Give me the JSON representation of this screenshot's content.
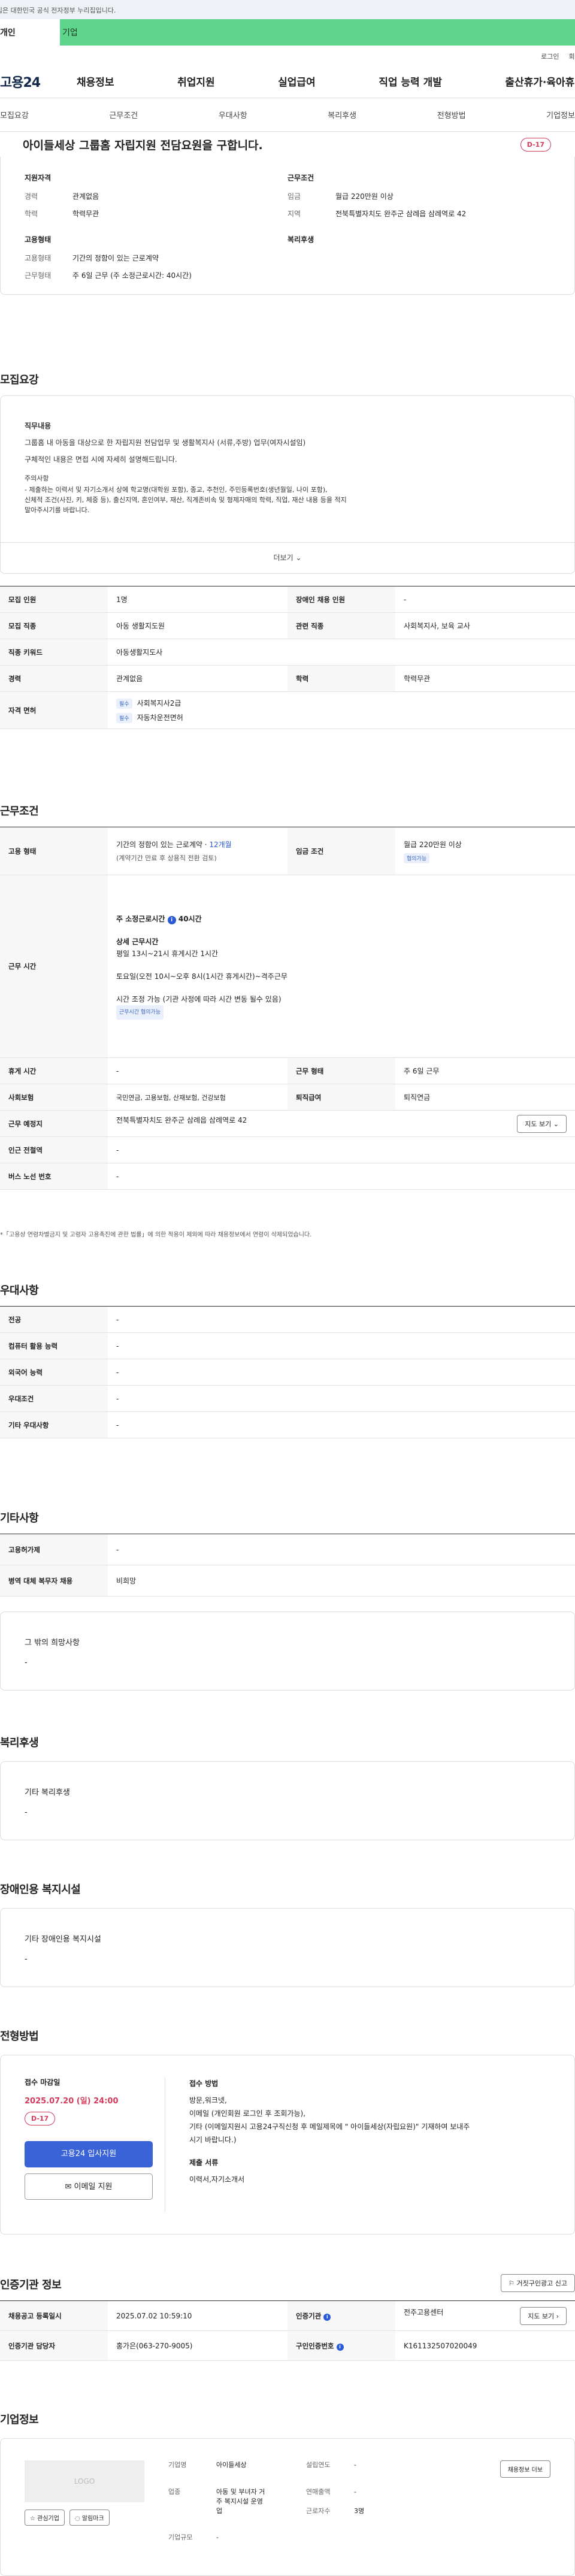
{
  "gov_banner": "이 누리집은 대한민국 공식 전자정부 누리집입니다.",
  "top_tabs": [
    "개인",
    "기업"
  ],
  "util_links": [
    "로그인",
    "회원가입"
  ],
  "logo": "고용24",
  "menu": [
    "채용정보",
    "취업지원",
    "실업급여",
    "직업 능력 개발",
    "출산휴가·육아휴직"
  ],
  "subnav": [
    "모집요강",
    "근무조건",
    "우대사항",
    "복리후생",
    "전형방법",
    "기업정보"
  ],
  "job_title": "아이들세상 그룹홈 자립지원 전담요원을 구합니다.",
  "dday": "D-17",
  "summary": {
    "qual_h": "지원자격",
    "cond_h": "근무조건",
    "emp_h": "고용형태",
    "welfare_h": "복리후생",
    "qual": [
      [
        "경력",
        "관계없음"
      ],
      [
        "학력",
        "학력무관"
      ]
    ],
    "cond": [
      [
        "임금",
        "월급 220만원 이상"
      ],
      [
        "지역",
        "전북특별자치도 완주군 삼례읍 삼례역로 42"
      ]
    ],
    "emp": [
      [
        "고용형태",
        "기간의 정함이 있는 근로계약"
      ],
      [
        "근무형태",
        "주 6일 근무 (주 소정근로시간: 40시간)"
      ]
    ]
  },
  "recruit": {
    "h": "모집요강",
    "desc_h": "직무내용",
    "desc_lines": [
      "그룹홈 내 아동을 대상으로 한 자립지원 전담업무 및 생활복지사 (서류,주방) 업무(여자시설임)",
      "구체적인 내용은 면접 시에 자세히 설명해드립니다.",
      "주의사항",
      "- 제출하는 이력서 및 자기소개서 상에 학교명(대학원 포함), 종교, 추천인, 주민등록번호(생년월일, 나이 포함),",
      "신체적 조건(사진, 키, 체중 등), 출신지역, 혼인여부, 재산, 직계존비속 및 형제자매의 학력, 직업, 재산 내용 등을 적지",
      "말아주시기를 바랍니다."
    ],
    "more": "더보기",
    "rows": [
      [
        "모집 인원",
        "1명",
        "장애인 채용 인원",
        "-"
      ],
      [
        "모집 직종",
        "아동 생활지도원",
        "관련 직종",
        "사회복지사, 보육 교사"
      ],
      [
        "직종 키워드",
        "아동생활지도사",
        "",
        ""
      ],
      [
        "경력",
        "관계없음",
        "학력",
        "학력무관"
      ]
    ],
    "license_h": "자격 면허",
    "licenses": [
      [
        "필수",
        "사회복지사2급"
      ],
      [
        "필수",
        "자동차운전면허"
      ]
    ]
  },
  "work": {
    "h": "근무조건",
    "emp_h": "고용 형태",
    "emp_v": "기간의 정함이 있는 근로계약 · ",
    "emp_months": "12개월",
    "emp_sub": "(계약기간 만료 후 상용직 전환 검토)",
    "wage_h": "임금 조건",
    "wage_v": "월급 220만원 이상",
    "wage_tag": "협의가능",
    "time_h": "근무 시간",
    "weekly": "주 소정근로시간",
    "weekly_hours": "40시간",
    "detail_h": "상세 근무시간",
    "detail1": "평일 13시~21시 휴게시간 1시간",
    "detail2": "토요일(오전 10시~오후 8시(1시간 휴게시간)~격주근무",
    "detail3": "시간 조정 가능 (기관 사정에 따라 시간 변동 될수 있음)",
    "time_tag": "근무시간 협의가능",
    "rest_h": "휴게 시간",
    "rest_v": "-",
    "shift_h": "근무 형태",
    "shift_v": "주 6일 근무",
    "ins_h": "사회보험",
    "ins_v": "국민연금, 고용보험, 산재보험, 건강보험",
    "ret_h": "퇴직급여",
    "ret_v": "퇴직연금",
    "loc_h": "근무 예정지",
    "loc_v": "전북특별자치도 완주군 삼례읍 삼례역로 42",
    "map_btn": "지도 보기",
    "sub_h": "인근 전철역",
    "sub_v": "-",
    "bus_h": "버스 노선 번호",
    "bus_v": "-",
    "note": "*「고용상 연령차별금지 및 고령자 고용촉진에 관한 법률」에 의한 적용이 제외에 따라 채용정보에서 연령이 삭제되었습니다."
  },
  "pref": {
    "h": "우대사항",
    "rows": [
      [
        "전공",
        "-"
      ],
      [
        "컴퓨터 활용 능력",
        "-"
      ],
      [
        "외국어 능력",
        "-"
      ],
      [
        "우대조건",
        "-"
      ],
      [
        "기타 우대사항",
        "-"
      ]
    ]
  },
  "etc": {
    "h": "기타사항",
    "rows": [
      [
        "고용허가제",
        "-"
      ],
      [
        "병역 대체 복무자 채용",
        "비희망"
      ]
    ],
    "hope_h": "그 밖의 희망사항",
    "hope_v": "-"
  },
  "welfare": {
    "h": "복리후생",
    "lbl": "기타 복리후생",
    "v": "-"
  },
  "disab": {
    "h": "장애인용 복지시설",
    "lbl": "기타 장애인용 복지시설",
    "v": "-"
  },
  "process": {
    "h": "전형방법",
    "deadline_h": "접수 마감일",
    "deadline": "2025.07.20 (일) 24:00",
    "dday": "D-17",
    "apply_btn": "고용24 입사지원",
    "email_btn": "이메일 지원",
    "method_h": "접수 방법",
    "method": [
      "방문,워크넷,",
      "이메일 (개인회원 로그인 후 조회가능),",
      "기타 (이메일지원시 고용24구직신청 후 메일제목에 \" 아이들세상(자립요원)\" 기재하여 보내주",
      "시기 바랍니다.)"
    ],
    "docs_h": "제출 서류",
    "docs": "이력서,자기소개서"
  },
  "cert": {
    "h": "인증기관 정보",
    "report_btn": "거짓구인광고 신고",
    "rows": [
      [
        "채용공고 등록일시",
        "2025.07.02 10:59:10",
        "인증기관",
        "전주고용센터"
      ],
      [
        "인증기관 담당자",
        "홍가은(063-270-9005)",
        "구인인증번호",
        "K161132507020049"
      ]
    ],
    "map_btn": "지도 보기"
  },
  "company": {
    "h": "기업정보",
    "logo": "LOGO",
    "fav_btn": "관심기업",
    "subscribe_btn": "알림마크",
    "name_k": "기업명",
    "name_v": "아이들세상",
    "found_k": "설립연도",
    "found_v": "-",
    "ind_k": "업종",
    "ind_v": [
      "아동 및 부녀자 거",
      "주 복지시설 운영",
      "업"
    ],
    "sales_k": "연매출액",
    "sales_v": "-",
    "emp_k": "근로자수",
    "emp_v": "3명",
    "size_k": "기업규모",
    "size_v": "-",
    "more_btn": "채용정보 더보"
  }
}
